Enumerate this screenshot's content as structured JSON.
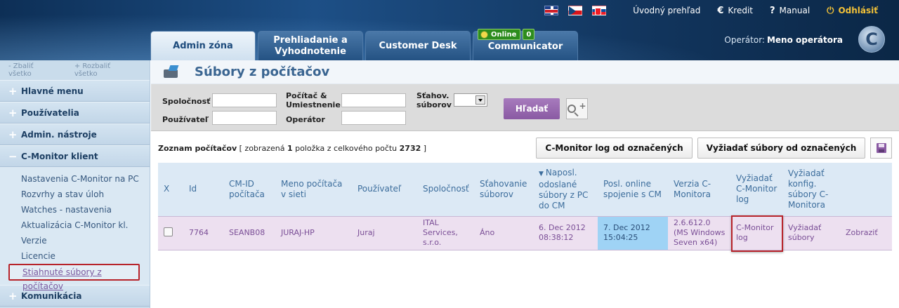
{
  "header": {
    "top_links": {
      "home": "Úvodný prehľad",
      "credit": "Kredit",
      "manual": "Manual",
      "logout": "Odhlásiť"
    },
    "tabs": [
      {
        "label": "Admin zóna",
        "active": true
      },
      {
        "label": "Prehliadanie a Vyhodnotenie",
        "active": false
      },
      {
        "label": "Customer Desk",
        "active": false
      },
      {
        "label": "Communicator",
        "active": false
      }
    ],
    "online_label": "Online",
    "online_count": "0",
    "operator_label": "Operátor:",
    "operator_name": "Meno operátora",
    "logo_letter": "C"
  },
  "sidebar": {
    "collapse_all": "Zbaliť všetko",
    "expand_all": "Rozbaliť všetko",
    "sections": [
      {
        "label": "Hlavné menu",
        "expanded": false
      },
      {
        "label": "Používatelia",
        "expanded": false
      },
      {
        "label": "Admin. nástroje",
        "expanded": false
      },
      {
        "label": "C-Monitor klient",
        "expanded": true
      },
      {
        "label": "Komunikácia",
        "expanded": false
      }
    ],
    "items": [
      "Nastavenia C-Monitor na PC",
      "Rozvrhy a stav úloh",
      "Watches - nastavenia",
      "Aktualizácia C-Monitor kl.",
      "Verzie",
      "Licencie",
      "Stiahnuté súbory z počítačov"
    ]
  },
  "page": {
    "title": "Súbory z počítačov"
  },
  "filter": {
    "company": "Spoločnosť",
    "user": "Používateľ",
    "computer_l1": "Počítač &",
    "computer_l2": "Umiestnenie",
    "operator": "Operátor",
    "download_l1": "Sťahov.",
    "download_l2": "súborov",
    "search_button": "Hľadať"
  },
  "list": {
    "title": "Zoznam počítačov",
    "summary_pre": "[ zobrazená",
    "count_shown": "1",
    "summary_mid": "položka z celkového počtu",
    "count_total": "2732",
    "summary_post": "]",
    "btn_log": "C-Monitor log od označených",
    "btn_request": "Vyžiadať súbory od označených"
  },
  "table": {
    "headers": {
      "x": "X",
      "id": "Id",
      "cmid": "CM-ID počítača",
      "name": "Meno počítača v sieti",
      "user": "Používateľ",
      "company": "Spoločnosť",
      "download": "Sťahovanie súborov",
      "last_sent": "Naposl. odoslané súbory z PC do CM",
      "last_online": "Posl. online spojenie s CM",
      "version": "Verzia C-Monitora",
      "req_log": "Vyžiadať C-Monitor log",
      "req_config": "Vyžiadať konfig. súbory C-Monitora"
    },
    "rows": [
      {
        "id": "7764",
        "cmid": "SEANB08",
        "name": "JURAJ-HP",
        "user": "Juraj",
        "company": "ITAL Services, s.r.o.",
        "download": "Áno",
        "last_sent": "6. Dec 2012 08:38:12",
        "last_online": "7. Dec 2012 15:04:25",
        "version": "2.6.612.0 (MS Windows Seven x64)",
        "req_log": "C-Monitor log",
        "req_config": "Vyžiadať súbory",
        "view": "Zobraziť"
      }
    ]
  },
  "colors": {
    "accent_purple": "#8a5aa3",
    "header_blue": "#1d4f86",
    "highlight_red": "#b7232a",
    "cell_highlight": "#9fd3f5"
  }
}
